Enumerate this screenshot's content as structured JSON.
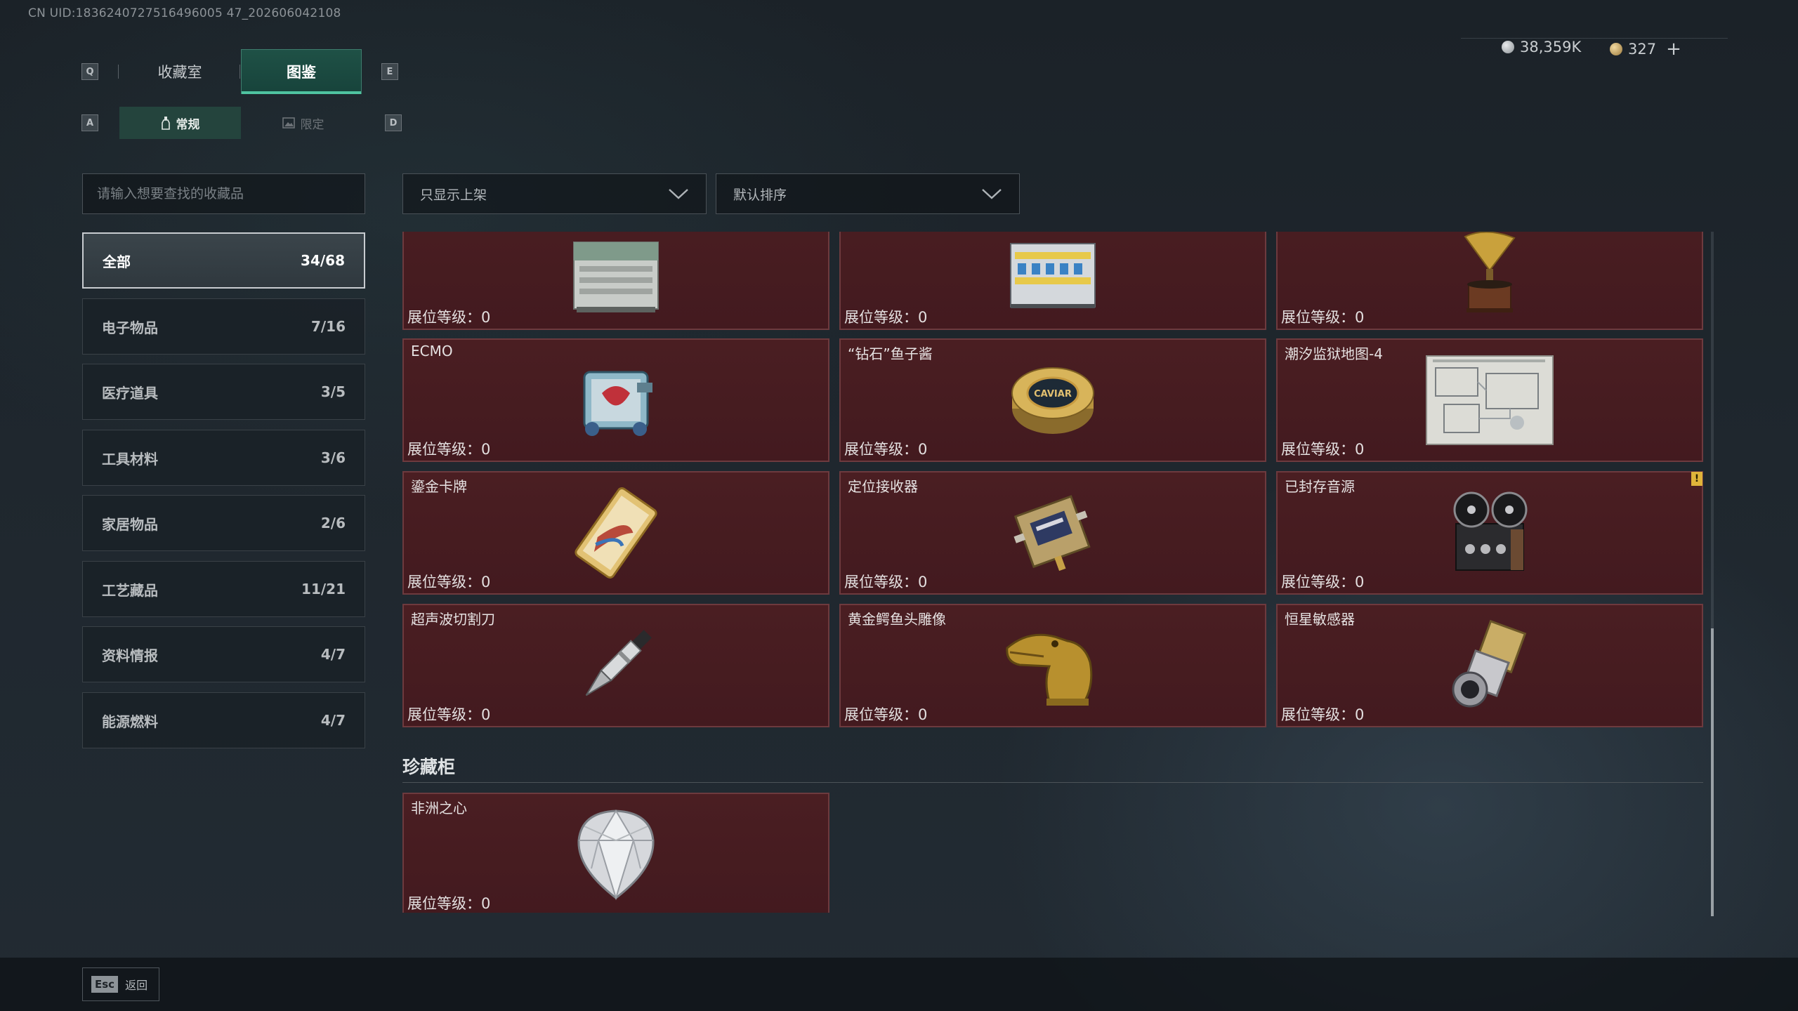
{
  "uid_text": "CN UID:1836240727516496005 47_202606042108",
  "top_tabs": {
    "left_key": "Q",
    "right_key": "E",
    "items": [
      {
        "label": "收藏室",
        "active": false
      },
      {
        "label": "图鉴",
        "active": true
      }
    ]
  },
  "sub_tabs": {
    "left_key": "A",
    "right_key": "D",
    "items": [
      {
        "label": "常规",
        "icon": "bottle-icon",
        "active": true
      },
      {
        "label": "限定",
        "icon": "image-icon",
        "active": false
      }
    ]
  },
  "currency": {
    "silver": "38,359K",
    "gold": "327",
    "add_label": "+"
  },
  "search": {
    "placeholder": "请输入想要查找的收藏品",
    "value": ""
  },
  "filters": {
    "display": "只显示上架",
    "sort": "默认排序"
  },
  "categories": [
    {
      "label": "全部",
      "count": "34/68",
      "active": true
    },
    {
      "label": "电子物品",
      "count": "7/16",
      "active": false
    },
    {
      "label": "医疗道具",
      "count": "3/5",
      "active": false
    },
    {
      "label": "工具材料",
      "count": "3/6",
      "active": false
    },
    {
      "label": "家居物品",
      "count": "2/6",
      "active": false
    },
    {
      "label": "工艺藏品",
      "count": "11/21",
      "active": false
    },
    {
      "label": "资料情报",
      "count": "4/7",
      "active": false
    },
    {
      "label": "能源燃料",
      "count": "4/7",
      "active": false
    }
  ],
  "level_label": "展位等级：",
  "items": [
    {
      "name": "",
      "level": "0",
      "icon": "toolbox-icon"
    },
    {
      "name": "",
      "level": "0",
      "icon": "battery-pack-icon"
    },
    {
      "name": "",
      "level": "0",
      "icon": "gramophone-icon"
    },
    {
      "name": "ECMO",
      "level": "0",
      "icon": "ecmo-machine-icon"
    },
    {
      "name": "“钻石”鱼子酱",
      "level": "0",
      "icon": "caviar-tin-icon",
      "tin_text": "CAVIAR"
    },
    {
      "name": "潮汐监狱地图-4",
      "level": "0",
      "icon": "map-icon"
    },
    {
      "name": "鎏金卡牌",
      "level": "0",
      "icon": "gilded-card-icon"
    },
    {
      "name": "定位接收器",
      "level": "0",
      "icon": "receiver-icon"
    },
    {
      "name": "已封存音源",
      "level": "0",
      "icon": "tape-recorder-icon",
      "badge": "!"
    },
    {
      "name": "超声波切割刀",
      "level": "0",
      "icon": "cutter-icon"
    },
    {
      "name": "黄金鳄鱼头雕像",
      "level": "0",
      "icon": "croc-statue-icon"
    },
    {
      "name": "恒星敏感器",
      "level": "0",
      "icon": "star-sensor-icon"
    }
  ],
  "section": {
    "title": "珍藏柜",
    "items": [
      {
        "name": "非洲之心",
        "level": "0",
        "icon": "diamond-icon"
      }
    ]
  },
  "footer": {
    "key": "Esc",
    "label": "返回"
  }
}
